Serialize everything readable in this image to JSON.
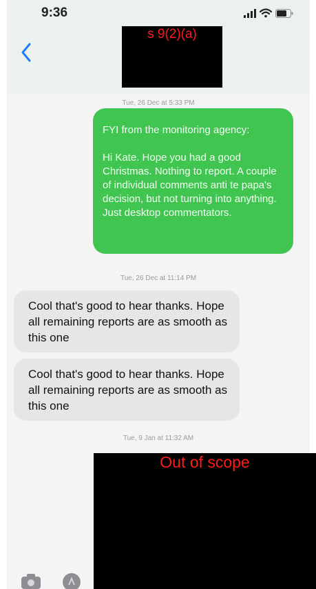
{
  "status_bar": {
    "time": "9:36"
  },
  "header": {
    "redaction_label": "s 9(2)(a)"
  },
  "messages": [
    {
      "timestamp": "Tue, 26 Dec at 5:33 PM",
      "direction": "outgoing",
      "lines": [
        "FYI from the monitoring agency:",
        "Hi Kate. Hope you had a good Christmas. Nothing to report. A couple of individual comments anti te papa's decision, but not turning into anything. Just desktop commentators."
      ]
    },
    {
      "timestamp": "Tue, 26 Dec at 11:14 PM",
      "direction": "incoming",
      "text": "Cool that's good to hear thanks. Hope all remaining reports are as smooth as this one"
    },
    {
      "direction": "incoming",
      "text": "Cool that's good to hear thanks. Hope all remaining reports are as smooth as this one"
    },
    {
      "timestamp": "Tue, 9 Jan at 11:32 AM"
    }
  ],
  "redactions": {
    "bottom_label": "Out of scope"
  },
  "colors": {
    "outgoing_bubble": "#3fc550",
    "incoming_bubble": "#e6e6e8",
    "ios_blue": "#1f7bf2",
    "redaction_text": "#ff1a1a"
  }
}
